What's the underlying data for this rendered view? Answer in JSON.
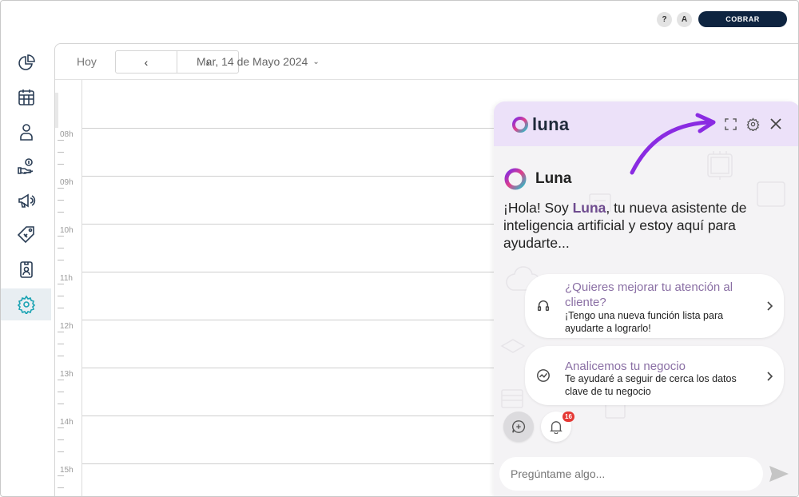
{
  "topbar": {
    "help_label": "?",
    "user_initial": "A",
    "cobrar_label": "COBRAR"
  },
  "sidebar": {
    "items": [
      {
        "icon": "pie-chart-icon"
      },
      {
        "icon": "calendar-icon"
      },
      {
        "icon": "user-icon"
      },
      {
        "icon": "money-hand-icon"
      },
      {
        "icon": "megaphone-icon"
      },
      {
        "icon": "tag-icon"
      },
      {
        "icon": "id-badge-icon"
      },
      {
        "icon": "gear-icon",
        "active": true
      }
    ]
  },
  "calendar": {
    "today_label": "Hoy",
    "prev_label": "‹",
    "next_label": "›",
    "date_label": "Mar, 14 de Mayo 2024",
    "hours": [
      "08h",
      "09h",
      "10h",
      "11h",
      "12h",
      "13h",
      "14h",
      "15h"
    ]
  },
  "luna": {
    "logo_text": "luna",
    "name": "Luna",
    "greeting_pre": "¡Hola! Soy ",
    "greeting_name": "Luna",
    "greeting_post": ", tu nueva asistente de inteligencia artificial y estoy aquí para ayudarte...",
    "cards": [
      {
        "icon": "headset-icon",
        "title": "¿Quieres mejorar tu atención al cliente?",
        "subtitle": "¡Tengo una nueva función lista para ayudarte a lograrlo!"
      },
      {
        "icon": "trend-chart-icon",
        "title": "Analicemos tu negocio",
        "subtitle": "Te ayudaré a seguir de cerca los datos clave de tu negocio"
      }
    ],
    "notification_count": "16",
    "input_placeholder": "Pregúntame algo...",
    "colors": {
      "header_bg": "#ece1f9",
      "accent": "#7d2ae8",
      "name_highlight": "#6e4b8f"
    }
  }
}
